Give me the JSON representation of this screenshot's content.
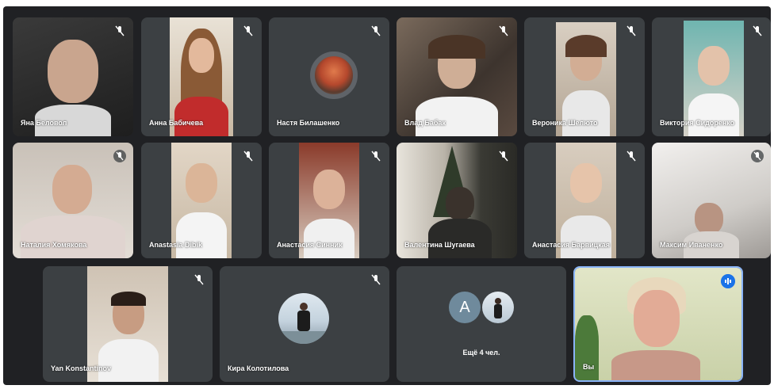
{
  "participants": [
    {
      "name": "Яна Беловол",
      "muted": true
    },
    {
      "name": "Анна Бабичева",
      "muted": true
    },
    {
      "name": "Настя Билашенко",
      "muted": true
    },
    {
      "name": "Влад Бабак",
      "muted": true
    },
    {
      "name": "Вероника Шелюто",
      "muted": true
    },
    {
      "name": "Виктория Сидоренко",
      "muted": true
    },
    {
      "name": "Наталия Хомякова",
      "muted": true
    },
    {
      "name": "Anastasia Dibik",
      "muted": true
    },
    {
      "name": "Анастасия Синник",
      "muted": true
    },
    {
      "name": "Валентина Шугаева",
      "muted": true
    },
    {
      "name": "Анастасия Барвицкая",
      "muted": true
    },
    {
      "name": "Максим Иваненко",
      "muted": true
    },
    {
      "name": "Yan Konstantinov",
      "muted": true
    },
    {
      "name": "Кира Колотилова",
      "muted": true
    },
    {
      "name": "Вы",
      "muted": false,
      "speaking": true
    }
  ],
  "more_tile": {
    "letter": "A",
    "label": "Ещё 4 чел."
  },
  "icons": {
    "mic_off": "mic-off-icon",
    "speaking": "audio-level-icon"
  },
  "colors": {
    "background": "#202124",
    "tile": "#3c4043",
    "active_speaker": "#1a73e8"
  }
}
